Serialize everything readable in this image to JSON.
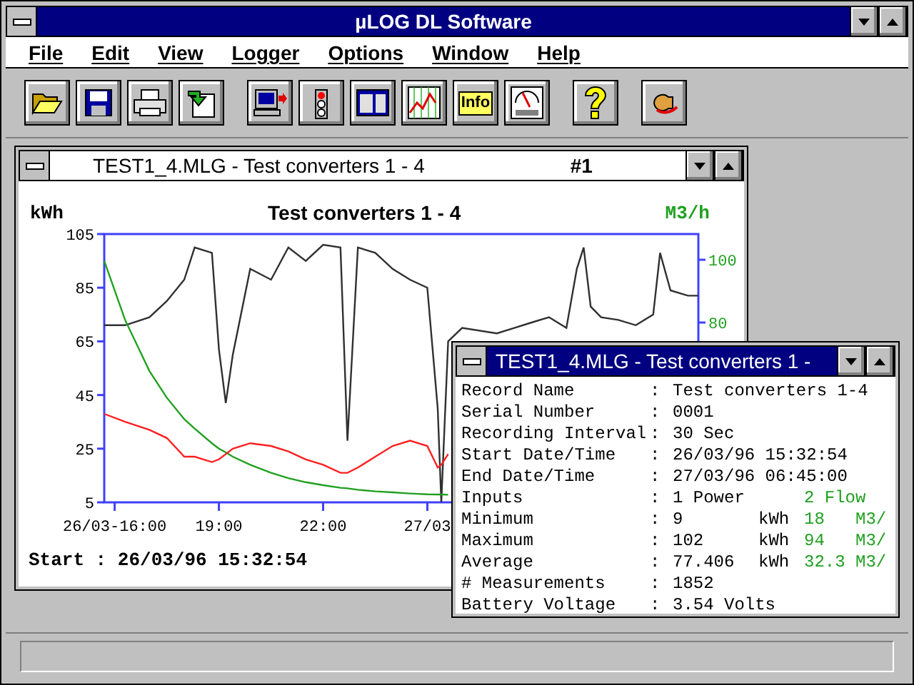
{
  "window": {
    "title": "µLOG DL Software"
  },
  "menu": [
    "File",
    "Edit",
    "View",
    "Logger",
    "Options",
    "Window",
    "Help"
  ],
  "toolbar": [
    [
      {
        "kind": "open"
      },
      {
        "kind": "save"
      },
      {
        "kind": "print"
      },
      {
        "kind": "import"
      }
    ],
    [
      {
        "kind": "computer"
      },
      {
        "kind": "light"
      },
      {
        "kind": "panel"
      },
      {
        "kind": "chart"
      },
      {
        "kind": "info",
        "label": "Info"
      },
      {
        "kind": "gauge"
      }
    ],
    [
      {
        "kind": "help"
      }
    ],
    [
      {
        "kind": "exit"
      }
    ]
  ],
  "chart_window": {
    "title": "TEST1_4.MLG  -  Test converters 1 - 4",
    "number": "#1",
    "active": false,
    "chart_data": {
      "type": "line",
      "title": "Test converters 1 - 4",
      "ylabel": "kWh",
      "y2label": "M3/h",
      "x": [
        15.7,
        16.3,
        17,
        17.5,
        18,
        18.3,
        18.8,
        19,
        19.2,
        19.4,
        19.9,
        20.5,
        21,
        21.5,
        22,
        22.5,
        22.7,
        23,
        23.5,
        24,
        24.5,
        25,
        25.3,
        25.4,
        25.6,
        26,
        27,
        27.5,
        28,
        28.5,
        29,
        29.3,
        29.5,
        29.7,
        30,
        30.5,
        31,
        31.5,
        31.7,
        32,
        32.5,
        32.8
      ],
      "series": [
        {
          "color": "#303030",
          "values": [
            71,
            71,
            74,
            80,
            88,
            100,
            98,
            62,
            42,
            60,
            92,
            88,
            100,
            95,
            101,
            100,
            28,
            100,
            98,
            92,
            88,
            85,
            40,
            5,
            65,
            70,
            68,
            70,
            72,
            74,
            70,
            92,
            100,
            78,
            74,
            73,
            71,
            75,
            98,
            84,
            82,
            82
          ]
        },
        {
          "color": "#20a020",
          "values": [
            95,
            73,
            54,
            44,
            36,
            32.5,
            27,
            25,
            23.6,
            22,
            19,
            16,
            14,
            12.5,
            11.4,
            10.4,
            10.2,
            9.7,
            9.1,
            8.7,
            8.3,
            8,
            7.9,
            7.9,
            7.8,
            null,
            null,
            null,
            null,
            null,
            null,
            null,
            null,
            null,
            null,
            null,
            null,
            null,
            null,
            null,
            null,
            null
          ]
        },
        {
          "color": "#ff2020",
          "values": [
            38,
            35,
            32,
            29,
            22,
            22,
            20,
            21,
            23,
            25,
            27,
            26,
            24,
            21,
            19,
            16,
            16,
            18,
            22,
            26,
            28,
            26,
            18,
            19,
            23,
            null,
            null,
            null,
            null,
            null,
            null,
            null,
            null,
            null,
            null,
            null,
            null,
            null,
            null,
            null,
            null,
            null
          ]
        }
      ],
      "xlim": [
        15.7,
        32.8
      ],
      "ylim": [
        5,
        105
      ],
      "yticks": [
        105,
        85,
        65,
        45,
        25,
        5
      ],
      "xticks": [
        {
          "value": 16,
          "label": "26/03-16:00"
        },
        {
          "value": 19,
          "label": "19:00"
        },
        {
          "value": 22,
          "label": "22:00"
        },
        {
          "value": 25,
          "label": "27/03"
        }
      ],
      "y2lim": [
        22.7,
        108.2
      ],
      "y2ticks": [
        {
          "value": 100,
          "label": "100"
        },
        {
          "value": 80,
          "label": "80"
        }
      ]
    },
    "footer": "Start : 26/03/96 15:32:54"
  },
  "info_window": {
    "title": "TEST1_4.MLG - Test converters 1 -",
    "active": true,
    "rows": [
      {
        "label": "Record Name",
        "sep": ":",
        "value": "Test converters 1-4"
      },
      {
        "label": "Serial Number",
        "sep": ":",
        "value": "0001"
      },
      {
        "label": "Recording Interval",
        "sep": ":",
        "value": "30 Sec"
      },
      {
        "label": "Start Date/Time",
        "sep": ":",
        "value": "26/03/96 15:32:54"
      },
      {
        "label": "End Date/Time",
        "sep": ":",
        "value": "27/03/96 06:45:00"
      },
      {
        "label": "Inputs",
        "sep": ":",
        "value": "1 Power",
        "value2": "2  Flow"
      },
      {
        "label": "Minimum",
        "sep": ":",
        "value": "9",
        "unit": "kWh",
        "value2": "18",
        "unit2": "M3/"
      },
      {
        "label": "Maximum",
        "sep": ":",
        "value": "102",
        "unit": "kWh",
        "value2": "94",
        "unit2": "M3/"
      },
      {
        "label": "Average",
        "sep": ":",
        "value": "77.406",
        "unit": "kWh",
        "value2": "32.3",
        "unit2": "M3/"
      },
      {
        "label": "# Measurements",
        "sep": ":",
        "value": "1852"
      },
      {
        "label": "Battery Voltage",
        "sep": ":",
        "value": "3.54 Volts"
      }
    ]
  }
}
